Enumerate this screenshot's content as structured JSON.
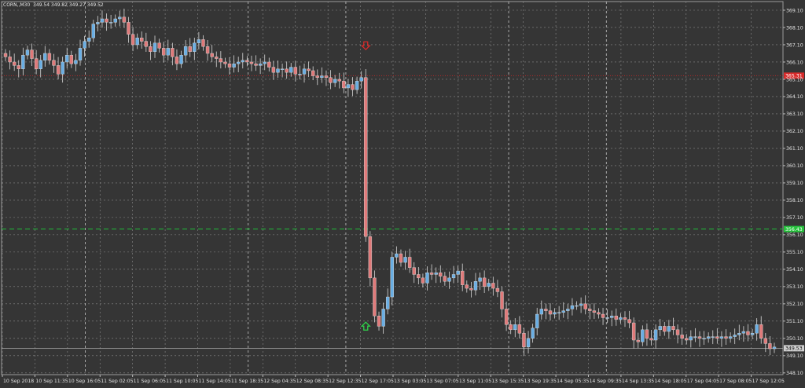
{
  "header": {
    "symbol": "CORN,,M30",
    "ohlc": "349.54 349.82 349.27 349.52"
  },
  "colors": {
    "background": "#353535",
    "grid": "#8a8a8a",
    "bull": "#6aaee3",
    "bear": "#e07a7a",
    "sell_line": "#b52a2a",
    "buy_line": "#1fbf3a",
    "price_line": "#a9a9a9",
    "axis_text": "#e0e0e0",
    "sell_arrow": "#e02a2a",
    "buy_arrow": "#2fd34a"
  },
  "chart_data": {
    "type": "candlestick",
    "timeframe": "M30",
    "ylim": [
      348.0,
      369.6
    ],
    "y_ticks": [
      369.1,
      368.1,
      367.1,
      366.1,
      365.1,
      364.1,
      363.1,
      362.1,
      361.1,
      360.1,
      359.1,
      358.1,
      357.1,
      356.1,
      355.1,
      354.1,
      353.1,
      352.1,
      351.1,
      350.1,
      349.1,
      348.1
    ],
    "x_labels": [
      "10 Sep 2018",
      "10 Sep 11:35",
      "10 Sep 16:05",
      "11 Sep 02:05",
      "11 Sep 06:05",
      "11 Sep 10:05",
      "11 Sep 14:05",
      "11 Sep 18:35",
      "12 Sep 04:35",
      "12 Sep 08:35",
      "12 Sep 12:35",
      "12 Sep 17:05",
      "13 Sep 03:05",
      "13 Sep 07:05",
      "13 Sep 11:05",
      "13 Sep 15:35",
      "13 Sep 19:35",
      "14 Sep 05:35",
      "14 Sep 09:35",
      "14 Sep 13:35",
      "14 Sep 18:05",
      "17 Sep 04:05",
      "17 Sep 08:05",
      "17 Sep 12:05"
    ],
    "lines": [
      {
        "name": "sell_level",
        "value": 365.31,
        "label": "365.31",
        "style": "dotted"
      },
      {
        "name": "buy_level",
        "value": 356.43,
        "label": "356.43",
        "style": "dashed"
      },
      {
        "name": "current_price",
        "value": 349.53,
        "label": "349.53",
        "style": "solid"
      }
    ],
    "closes": [
      366.4,
      366.1,
      365.9,
      365.7,
      366.5,
      366.8,
      366.3,
      365.7,
      366.2,
      366.6,
      366.2,
      365.9,
      365.4,
      366.1,
      366.5,
      366.0,
      366.2,
      366.9,
      367.3,
      367.5,
      368.3,
      368.4,
      368.6,
      368.4,
      368.4,
      368.6,
      368.7,
      368.4,
      367.7,
      367.1,
      367.5,
      367.3,
      367.0,
      366.7,
      367.2,
      366.9,
      366.5,
      366.9,
      366.4,
      366.0,
      366.5,
      367.0,
      366.7,
      367.2,
      367.4,
      367.0,
      366.6,
      366.4,
      366.3,
      366.1,
      366.0,
      365.8,
      366.0,
      366.1,
      366.2,
      366.1,
      366.0,
      365.9,
      366.0,
      366.1,
      365.8,
      365.5,
      365.7,
      365.7,
      365.5,
      365.8,
      365.4,
      365.4,
      365.7,
      365.6,
      365.3,
      365.2,
      365.3,
      365.2,
      364.9,
      365.1,
      365.0,
      364.6,
      364.8,
      364.5,
      365.0,
      365.2,
      356.0,
      353.6,
      351.4,
      350.8,
      351.8,
      352.5,
      354.8,
      355.0,
      354.5,
      354.8,
      354.2,
      353.8,
      353.6,
      353.3,
      353.9,
      353.8,
      353.9,
      353.7,
      353.4,
      353.6,
      353.8,
      354.0,
      353.2,
      353.0,
      352.9,
      353.4,
      353.6,
      353.1,
      353.3,
      353.0,
      352.8,
      351.8,
      350.9,
      350.6,
      350.9,
      350.4,
      349.6,
      350.1,
      350.7,
      351.5,
      351.8,
      351.7,
      351.5,
      351.6,
      351.6,
      351.7,
      351.8,
      352.0,
      352.0,
      352.1,
      351.8,
      351.7,
      351.6,
      351.5,
      351.3,
      351.3,
      351.4,
      351.2,
      351.3,
      351.2,
      351.0,
      350.0,
      349.9,
      350.6,
      350.1,
      350.0,
      350.6,
      350.8,
      350.5,
      350.8,
      350.6,
      350.3,
      350.1,
      350.0,
      350.2,
      350.2,
      350.1,
      350.1,
      350.2,
      350.2,
      350.1,
      350.2,
      350.1,
      350.2,
      350.3,
      350.4,
      350.5,
      350.3,
      350.4,
      350.9,
      350.1,
      349.8,
      349.5,
      349.6
    ]
  }
}
